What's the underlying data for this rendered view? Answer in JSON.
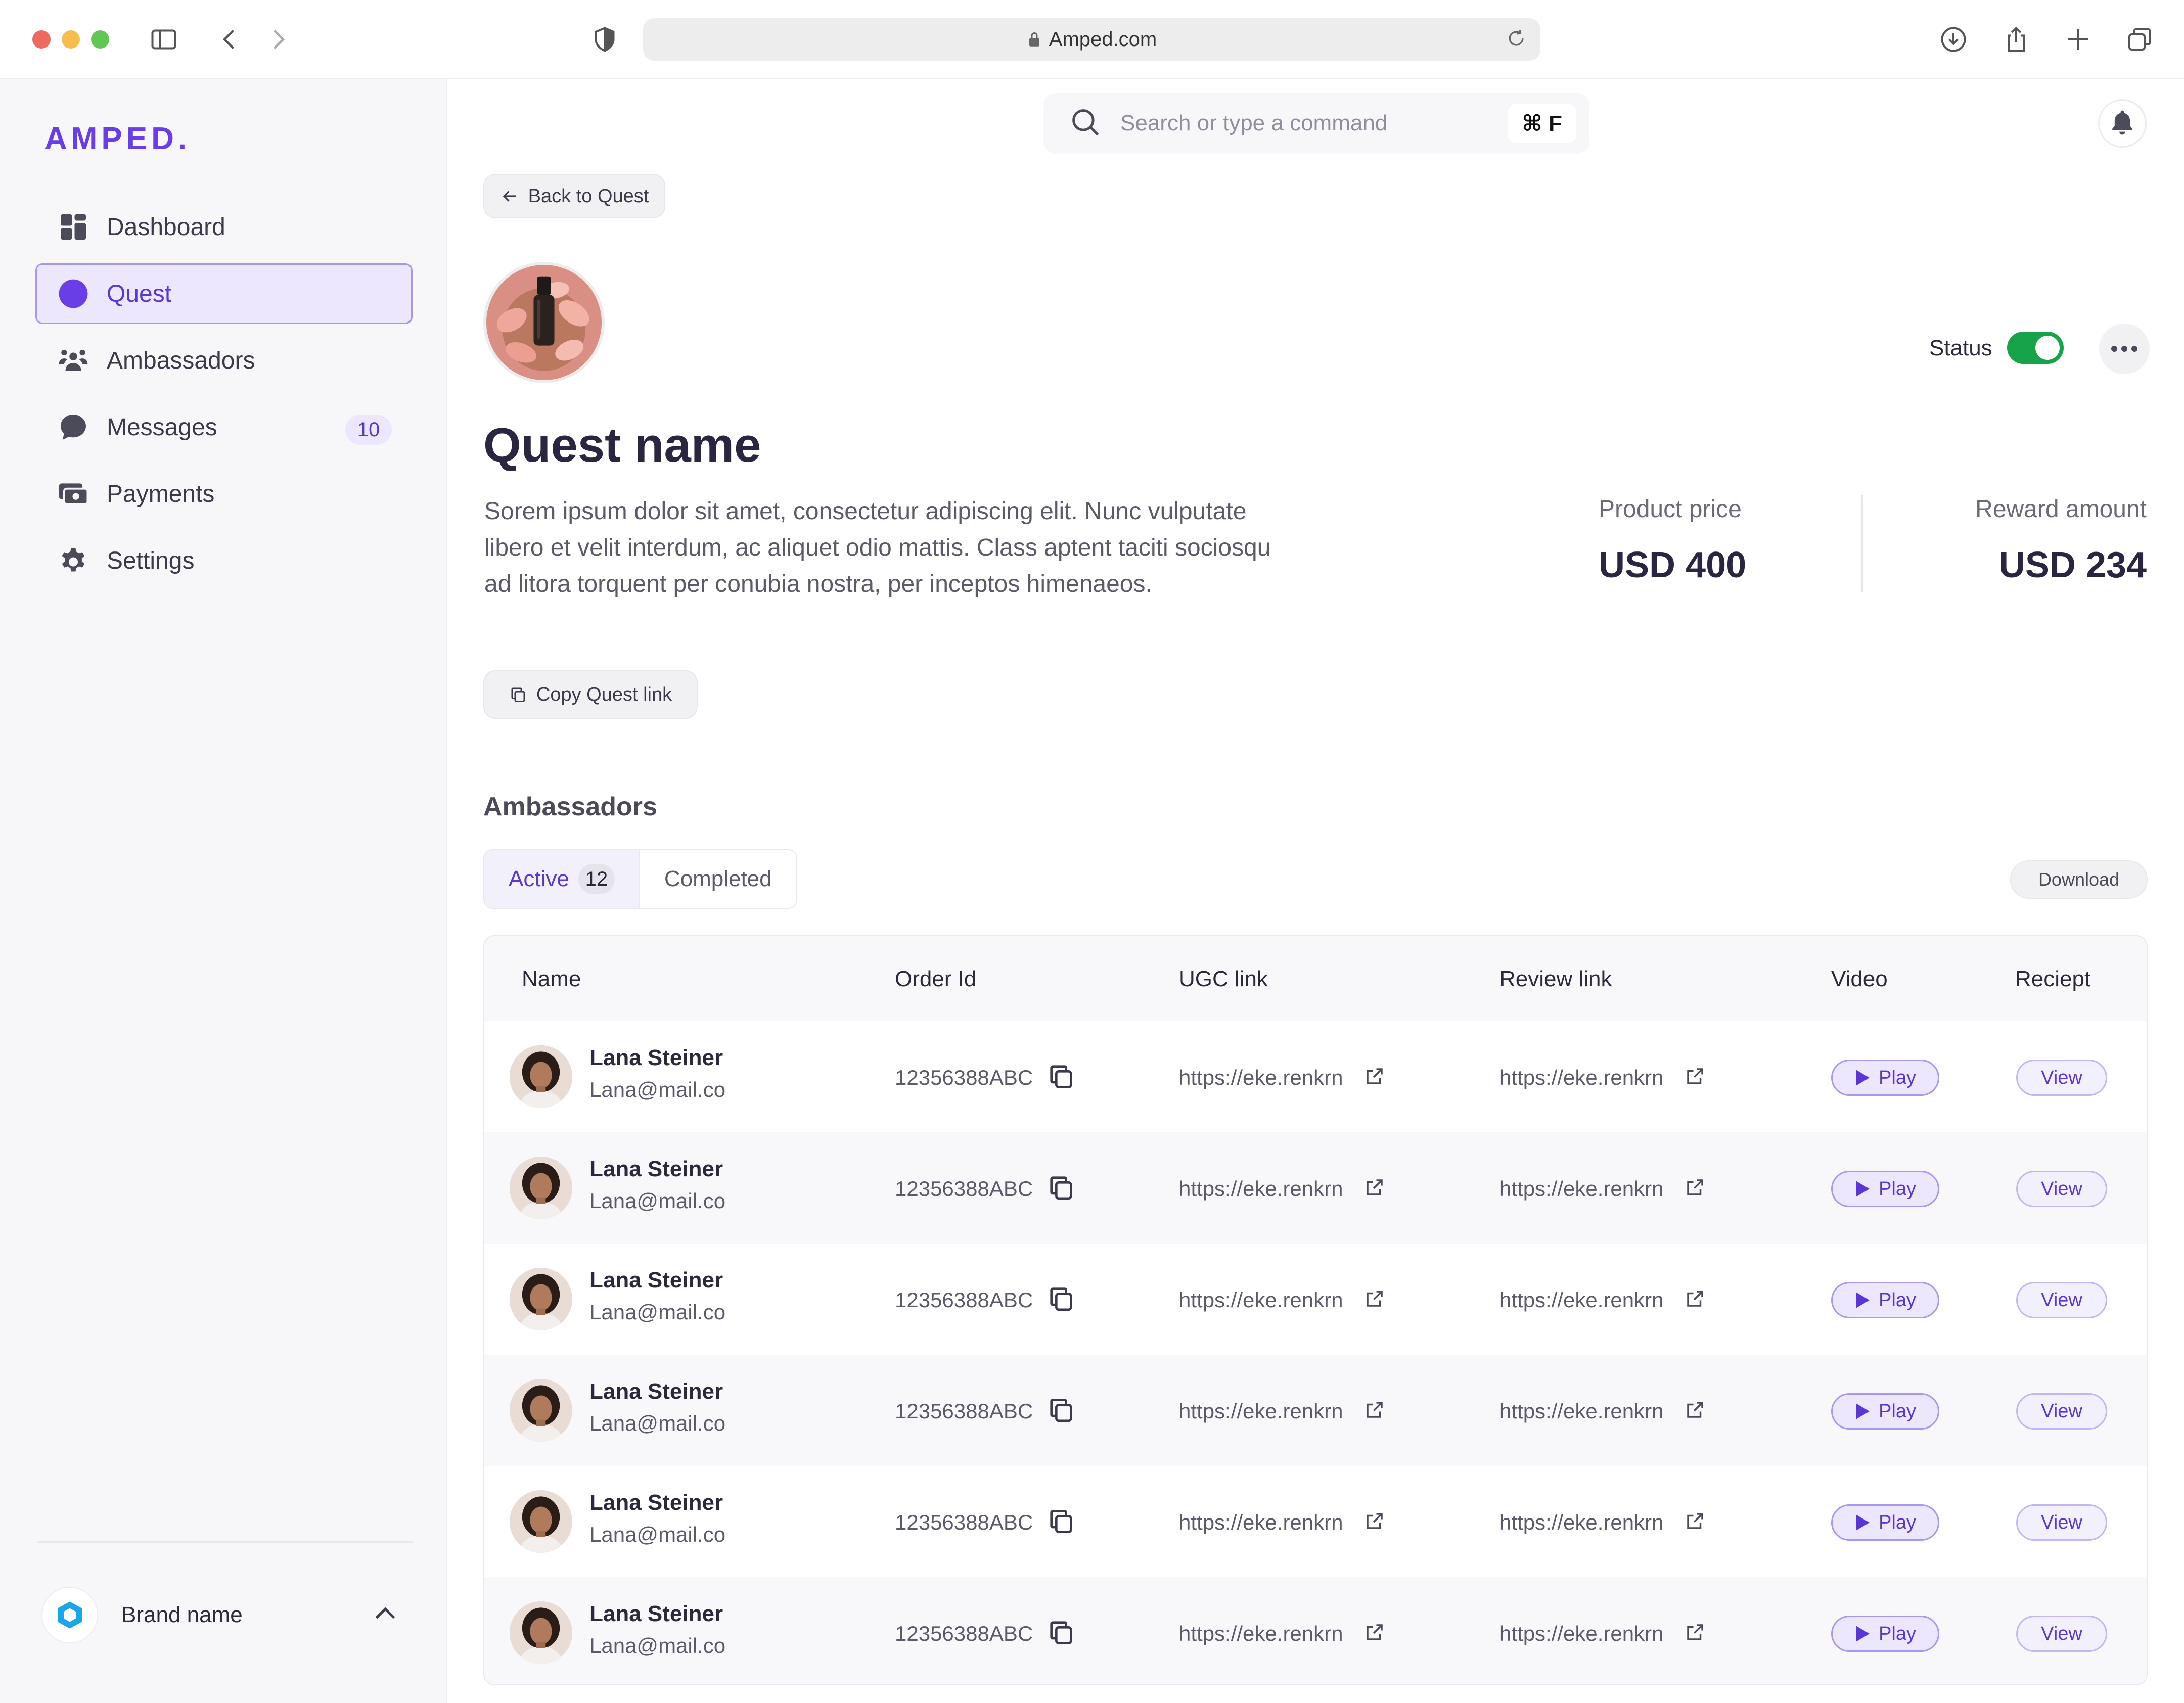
{
  "browser": {
    "url": "Amped.com"
  },
  "sidebar": {
    "logo": "AMPED.",
    "items": [
      {
        "label": "Dashboard",
        "icon": "dashboard-icon"
      },
      {
        "label": "Quest",
        "icon": "quest-icon",
        "active": true
      },
      {
        "label": "Ambassadors",
        "icon": "ambassadors-icon"
      },
      {
        "label": "Messages",
        "icon": "messages-icon",
        "badge": "10"
      },
      {
        "label": "Payments",
        "icon": "payments-icon"
      },
      {
        "label": "Settings",
        "icon": "gear-icon"
      }
    ],
    "brand": {
      "name": "Brand name"
    }
  },
  "topbar": {
    "search_placeholder": "Search or type a command",
    "shortcut": "⌘ F"
  },
  "quest": {
    "back_label": "Back to Quest",
    "status_label": "Status",
    "status_on": true,
    "title": "Quest name",
    "description": "Sorem ipsum dolor sit amet, consectetur adipiscing elit. Nunc vulputate libero et velit interdum, ac aliquet odio mattis. Class aptent taciti sociosqu ad litora torquent per conubia nostra, per inceptos himenaeos.",
    "copy_link_label": "Copy Quest link",
    "product_price_label": "Product price",
    "product_price_value": "USD 400",
    "reward_label": "Reward amount",
    "reward_value": "USD 234"
  },
  "ambassadors": {
    "section_title": "Ambassadors",
    "tabs": [
      {
        "label": "Active",
        "count": "12",
        "active": true
      },
      {
        "label": "Completed"
      }
    ],
    "download_label": "Download",
    "columns": [
      "Name",
      "Order Id",
      "UGC link",
      "Review link",
      "Video",
      "Reciept"
    ],
    "rows": [
      {
        "name": "Lana Steiner",
        "email": "Lana@mail.co",
        "order_id": "12356388ABC",
        "ugc_link": "https://eke.renkrn",
        "review_link": "https://eke.renkrn",
        "video": "Play",
        "receipt": "View"
      },
      {
        "name": "Lana Steiner",
        "email": "Lana@mail.co",
        "order_id": "12356388ABC",
        "ugc_link": "https://eke.renkrn",
        "review_link": "https://eke.renkrn",
        "video": "Play",
        "receipt": "View"
      },
      {
        "name": "Lana Steiner",
        "email": "Lana@mail.co",
        "order_id": "12356388ABC",
        "ugc_link": "https://eke.renkrn",
        "review_link": "https://eke.renkrn",
        "video": "Play",
        "receipt": "View"
      },
      {
        "name": "Lana Steiner",
        "email": "Lana@mail.co",
        "order_id": "12356388ABC",
        "ugc_link": "https://eke.renkrn",
        "review_link": "https://eke.renkrn",
        "video": "Play",
        "receipt": "View"
      },
      {
        "name": "Lana Steiner",
        "email": "Lana@mail.co",
        "order_id": "12356388ABC",
        "ugc_link": "https://eke.renkrn",
        "review_link": "https://eke.renkrn",
        "video": "Play",
        "receipt": "View"
      },
      {
        "name": "Lana Steiner",
        "email": "Lana@mail.co",
        "order_id": "12356388ABC",
        "ugc_link": "https://eke.renkrn",
        "review_link": "https://eke.renkrn",
        "video": "Play",
        "receipt": "View"
      }
    ]
  },
  "colors": {
    "accent": "#6a3ee6",
    "status_on": "#16a34a"
  }
}
